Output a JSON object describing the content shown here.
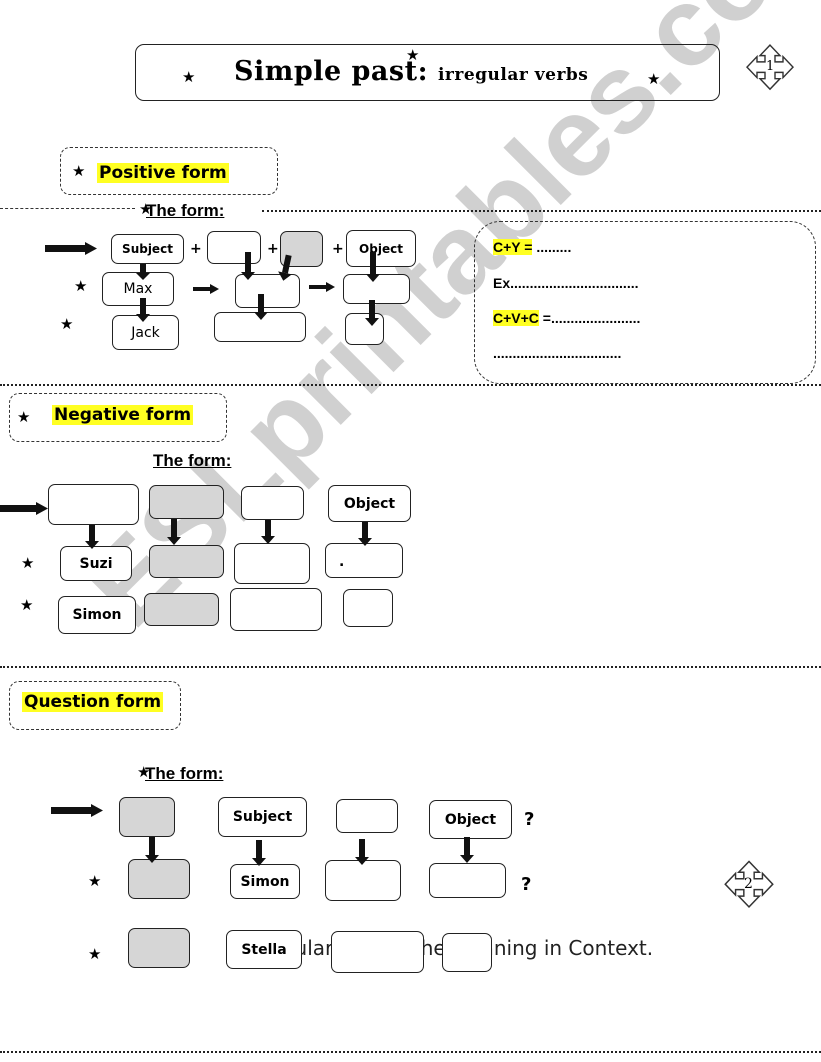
{
  "header": {
    "title_main": "Simple past:",
    "title_sub": "irregular verbs",
    "page_badges": [
      "1",
      "2"
    ]
  },
  "positive": {
    "heading": "Positive form",
    "form_label": "The form:",
    "top_row": [
      "Subject",
      "",
      "",
      "Object"
    ],
    "plus_signs": [
      "+",
      "+",
      "+"
    ],
    "examples": [
      "Max",
      "Jack"
    ],
    "rule_box": {
      "line1_label": "C+Y =",
      "line1_fill": " .........",
      "line2": "Ex.................................",
      "line3_label": "C+V+C",
      "line3_fill": " =.......................",
      "line4": "................................."
    }
  },
  "negative": {
    "heading": "Negative form",
    "form_label": "The form:",
    "top_row": [
      "",
      "",
      "",
      "Object"
    ],
    "examples": [
      "Suzi",
      "Simon"
    ],
    "dot_mark": "."
  },
  "question": {
    "heading": "Question form",
    "form_label": "The form:",
    "top_row": [
      "",
      "Subject",
      "",
      "Object"
    ],
    "examples": [
      "Simon",
      "Stella"
    ],
    "question_mark": "?",
    "background_text": "Irregular Verbs: The Meaning in Context."
  },
  "watermark": "ESLprintables.com"
}
